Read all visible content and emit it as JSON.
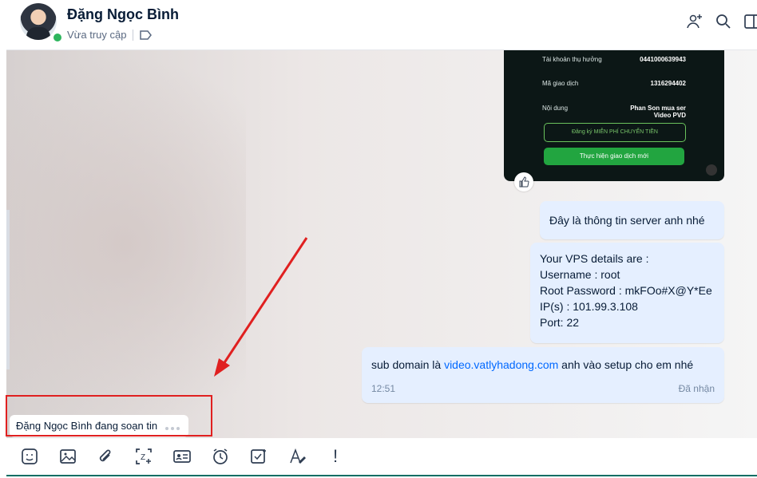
{
  "header": {
    "name": "Đặng Ngọc Bình",
    "status": "Vừa truy cập"
  },
  "image_message": {
    "rows": [
      {
        "label": "Tài khoản thụ hưởng",
        "value": "0441000639943"
      },
      {
        "label": "Mã giao dịch",
        "value": "1316294402"
      },
      {
        "label": "Nội dung",
        "value": "Phan Son mua ser Video PVD"
      }
    ],
    "secondary_button": "Đăng ký MIỄN PHÍ CHUYỂN TIỀN",
    "primary_button": "Thực hiện giao dịch mới"
  },
  "messages": [
    {
      "text": "Đây là thông tin server anh nhé"
    },
    {
      "lines": [
        "Your VPS details are :",
        "Username : root",
        "Root Password : mkFOo#X@Y*Ee",
        "IP(s) : 101.99.3.108",
        "Port: 22"
      ]
    },
    {
      "prefix": "sub domain là ",
      "link": "video.vatlyhadong.com",
      "suffix": " anh vào setup cho em nhé",
      "time": "12:51",
      "status": "Đã nhận"
    }
  ],
  "typing_indicator": "Đặng Ngọc Bình đang soạn tin",
  "toolbar": {
    "icons": [
      "sticker-icon",
      "image-icon",
      "attachment-icon",
      "screenshot-icon",
      "contact-card-icon",
      "reminder-icon",
      "task-icon",
      "text-format-icon",
      "important-icon"
    ],
    "important_glyph": "!"
  },
  "colors": {
    "accent": "#0068ff",
    "bubble": "#e5efff",
    "highlight": "#e02020",
    "online": "#2db55d"
  }
}
